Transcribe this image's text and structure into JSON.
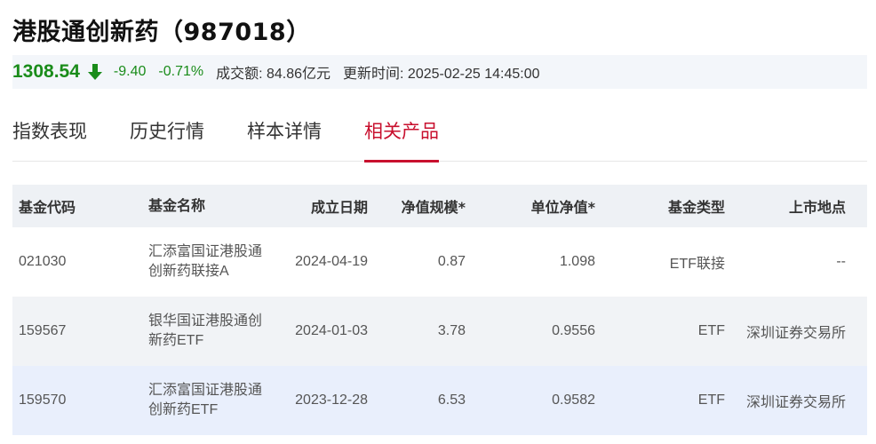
{
  "index": {
    "title": "港股通创新药（987018）",
    "price": "1308.54",
    "change": "-9.40",
    "change_pct": "-0.71%",
    "turnover": "成交额: 84.86亿元",
    "update_time": "更新时间: 2025-02-25 14:45:00",
    "down_color": "#1a8c1a"
  },
  "tabs": [
    {
      "label": "指数表现"
    },
    {
      "label": "历史行情"
    },
    {
      "label": "样本详情"
    },
    {
      "label": "相关产品",
      "active": true
    }
  ],
  "table": {
    "headers": {
      "code": "基金代码",
      "name": "基金名称",
      "date": "成立日期",
      "scale": "净值规模*",
      "nav": "单位净值*",
      "type": "基金类型",
      "market": "上市地点"
    },
    "rows": [
      {
        "code": "021030",
        "name": "汇添富国证港股通创新药联接A",
        "date": "2024-04-19",
        "scale": "0.87",
        "nav": "1.098",
        "type": "ETF联接",
        "market": "--"
      },
      {
        "code": "159567",
        "name": "银华国证港股通创新药ETF",
        "date": "2024-01-03",
        "scale": "3.78",
        "nav": "0.9556",
        "type": "ETF",
        "market": "深圳证券交易所"
      },
      {
        "code": "159570",
        "name": "汇添富国证港股通创新药ETF",
        "date": "2023-12-28",
        "scale": "6.53",
        "nav": "0.9582",
        "type": "ETF",
        "market": "深圳证券交易所"
      }
    ]
  }
}
